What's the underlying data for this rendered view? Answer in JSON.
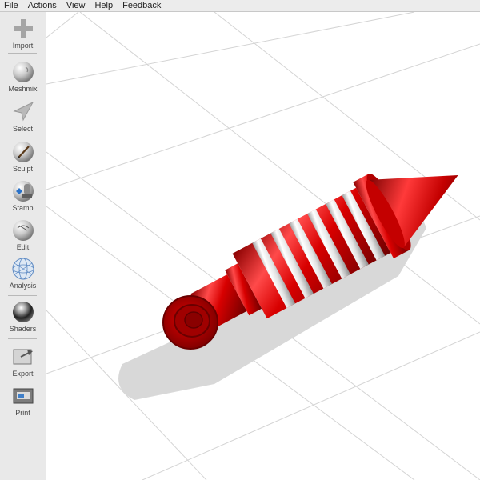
{
  "menu": [
    "File",
    "Actions",
    "View",
    "Help",
    "Feedback"
  ],
  "tools": [
    {
      "name": "import",
      "label": "Import",
      "icon": "plus-icon"
    },
    {
      "name": "meshmix",
      "label": "Meshmix",
      "icon": "meshmix-ball-icon"
    },
    {
      "name": "select",
      "label": "Select",
      "icon": "arrow-icon"
    },
    {
      "name": "sculpt",
      "label": "Sculpt",
      "icon": "brush-icon"
    },
    {
      "name": "stamp",
      "label": "Stamp",
      "icon": "stamp-icon"
    },
    {
      "name": "edit",
      "label": "Edit",
      "icon": "edit-ball-icon"
    },
    {
      "name": "analysis",
      "label": "Analysis",
      "icon": "wireframe-ball-icon"
    },
    {
      "name": "shaders",
      "label": "Shaders",
      "icon": "chrome-ball-icon"
    },
    {
      "name": "export",
      "label": "Export",
      "icon": "export-icon"
    },
    {
      "name": "print",
      "label": "Print",
      "icon": "printer-icon"
    }
  ],
  "colors": {
    "model_red": "#c80000",
    "model_white": "#f0f0f0",
    "shadow": "#d9d9d9",
    "grid": "#d2d2d2"
  }
}
